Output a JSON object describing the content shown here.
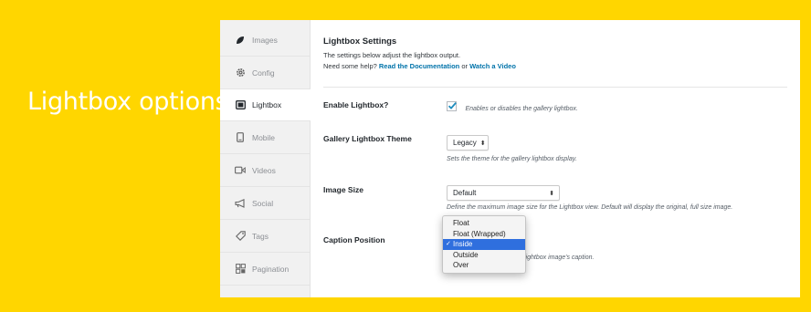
{
  "slide": {
    "title": "Lightbox options"
  },
  "colors": {
    "background": "#ffd600",
    "link": "#0073aa",
    "selection": "#2f6fde"
  },
  "sidebar": {
    "items": [
      {
        "label": "Images",
        "icon": "leaf-icon"
      },
      {
        "label": "Config",
        "icon": "gear-icon"
      },
      {
        "label": "Lightbox",
        "icon": "lightbox-icon",
        "active": true
      },
      {
        "label": "Mobile",
        "icon": "mobile-icon"
      },
      {
        "label": "Videos",
        "icon": "video-icon"
      },
      {
        "label": "Social",
        "icon": "megaphone-icon"
      },
      {
        "label": "Tags",
        "icon": "tag-icon"
      },
      {
        "label": "Pagination",
        "icon": "pagination-icon"
      }
    ]
  },
  "settings": {
    "title": "Lightbox Settings",
    "description": "The settings below adjust the lightbox output.",
    "help_prefix": "Need some help?",
    "doc_link": "Read the Documentation",
    "help_or": "or",
    "video_link": "Watch a Video"
  },
  "fields": {
    "enable_lightbox": {
      "label": "Enable Lightbox?",
      "checked": true,
      "hint": "Enables or disables the gallery lightbox."
    },
    "theme": {
      "label": "Gallery Lightbox Theme",
      "value": "Legacy",
      "hint": "Sets the theme for the gallery lightbox display."
    },
    "image_size": {
      "label": "Image Size",
      "value": "Default",
      "hint": "Define the maximum image size for the Lightbox view. Default will display the original, full size image."
    },
    "caption_position": {
      "label": "Caption Position",
      "hint": "lightbox image's caption.",
      "options": [
        "Float",
        "Float (Wrapped)",
        "Inside",
        "Outside",
        "Over"
      ],
      "selected": "Inside"
    }
  }
}
